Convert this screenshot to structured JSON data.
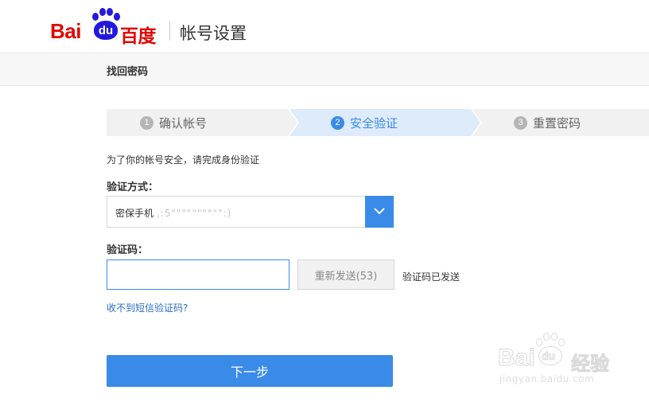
{
  "header": {
    "logo_bai": "Bai",
    "logo_du": "du",
    "logo_cn": "百度",
    "title": "帐号设置"
  },
  "subbar": {
    "title": "找回密码"
  },
  "steps": [
    {
      "num": "1",
      "label": "确认帐号",
      "state": "done"
    },
    {
      "num": "2",
      "label": "安全验证",
      "state": "active"
    },
    {
      "num": "3",
      "label": "重置密码",
      "state": "pending"
    }
  ],
  "form": {
    "tip": "为了你的帐号安全，请完成身份验证",
    "method_label": "验证方式：",
    "method_value": "密保手机",
    "method_mask": ",:5\"\"\"\"\"\"\"\"\"\":)",
    "code_label": "验证码：",
    "code_value": "",
    "resend_label": "重新发送(53)",
    "sent_tip": "验证码已发送",
    "no_sms_link": "收不到短信验证码?",
    "next_label": "下一步"
  },
  "watermark": {
    "text": "Bai",
    "paw_text": "du",
    "cn": "经验",
    "url": "jingyan.baidu.com"
  },
  "colors": {
    "brand_red": "#e10602",
    "brand_blue": "#2319dc",
    "accent": "#3a8be8",
    "link": "#2d6fc4"
  }
}
